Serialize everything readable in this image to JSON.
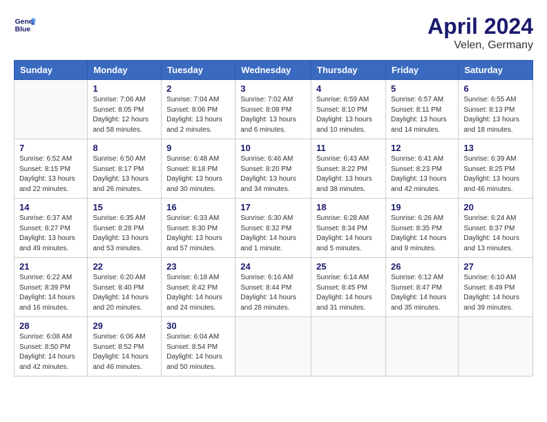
{
  "header": {
    "logo_line1": "General",
    "logo_line2": "Blue",
    "month": "April 2024",
    "location": "Velen, Germany"
  },
  "weekdays": [
    "Sunday",
    "Monday",
    "Tuesday",
    "Wednesday",
    "Thursday",
    "Friday",
    "Saturday"
  ],
  "weeks": [
    [
      {
        "day": "",
        "sunrise": "",
        "sunset": "",
        "daylight": ""
      },
      {
        "day": "1",
        "sunrise": "Sunrise: 7:06 AM",
        "sunset": "Sunset: 8:05 PM",
        "daylight": "Daylight: 12 hours and 58 minutes."
      },
      {
        "day": "2",
        "sunrise": "Sunrise: 7:04 AM",
        "sunset": "Sunset: 8:06 PM",
        "daylight": "Daylight: 13 hours and 2 minutes."
      },
      {
        "day": "3",
        "sunrise": "Sunrise: 7:02 AM",
        "sunset": "Sunset: 8:08 PM",
        "daylight": "Daylight: 13 hours and 6 minutes."
      },
      {
        "day": "4",
        "sunrise": "Sunrise: 6:59 AM",
        "sunset": "Sunset: 8:10 PM",
        "daylight": "Daylight: 13 hours and 10 minutes."
      },
      {
        "day": "5",
        "sunrise": "Sunrise: 6:57 AM",
        "sunset": "Sunset: 8:11 PM",
        "daylight": "Daylight: 13 hours and 14 minutes."
      },
      {
        "day": "6",
        "sunrise": "Sunrise: 6:55 AM",
        "sunset": "Sunset: 8:13 PM",
        "daylight": "Daylight: 13 hours and 18 minutes."
      }
    ],
    [
      {
        "day": "7",
        "sunrise": "Sunrise: 6:52 AM",
        "sunset": "Sunset: 8:15 PM",
        "daylight": "Daylight: 13 hours and 22 minutes."
      },
      {
        "day": "8",
        "sunrise": "Sunrise: 6:50 AM",
        "sunset": "Sunset: 8:17 PM",
        "daylight": "Daylight: 13 hours and 26 minutes."
      },
      {
        "day": "9",
        "sunrise": "Sunrise: 6:48 AM",
        "sunset": "Sunset: 8:18 PM",
        "daylight": "Daylight: 13 hours and 30 minutes."
      },
      {
        "day": "10",
        "sunrise": "Sunrise: 6:46 AM",
        "sunset": "Sunset: 8:20 PM",
        "daylight": "Daylight: 13 hours and 34 minutes."
      },
      {
        "day": "11",
        "sunrise": "Sunrise: 6:43 AM",
        "sunset": "Sunset: 8:22 PM",
        "daylight": "Daylight: 13 hours and 38 minutes."
      },
      {
        "day": "12",
        "sunrise": "Sunrise: 6:41 AM",
        "sunset": "Sunset: 8:23 PM",
        "daylight": "Daylight: 13 hours and 42 minutes."
      },
      {
        "day": "13",
        "sunrise": "Sunrise: 6:39 AM",
        "sunset": "Sunset: 8:25 PM",
        "daylight": "Daylight: 13 hours and 46 minutes."
      }
    ],
    [
      {
        "day": "14",
        "sunrise": "Sunrise: 6:37 AM",
        "sunset": "Sunset: 8:27 PM",
        "daylight": "Daylight: 13 hours and 49 minutes."
      },
      {
        "day": "15",
        "sunrise": "Sunrise: 6:35 AM",
        "sunset": "Sunset: 8:28 PM",
        "daylight": "Daylight: 13 hours and 53 minutes."
      },
      {
        "day": "16",
        "sunrise": "Sunrise: 6:33 AM",
        "sunset": "Sunset: 8:30 PM",
        "daylight": "Daylight: 13 hours and 57 minutes."
      },
      {
        "day": "17",
        "sunrise": "Sunrise: 6:30 AM",
        "sunset": "Sunset: 8:32 PM",
        "daylight": "Daylight: 14 hours and 1 minute."
      },
      {
        "day": "18",
        "sunrise": "Sunrise: 6:28 AM",
        "sunset": "Sunset: 8:34 PM",
        "daylight": "Daylight: 14 hours and 5 minutes."
      },
      {
        "day": "19",
        "sunrise": "Sunrise: 6:26 AM",
        "sunset": "Sunset: 8:35 PM",
        "daylight": "Daylight: 14 hours and 9 minutes."
      },
      {
        "day": "20",
        "sunrise": "Sunrise: 6:24 AM",
        "sunset": "Sunset: 8:37 PM",
        "daylight": "Daylight: 14 hours and 13 minutes."
      }
    ],
    [
      {
        "day": "21",
        "sunrise": "Sunrise: 6:22 AM",
        "sunset": "Sunset: 8:39 PM",
        "daylight": "Daylight: 14 hours and 16 minutes."
      },
      {
        "day": "22",
        "sunrise": "Sunrise: 6:20 AM",
        "sunset": "Sunset: 8:40 PM",
        "daylight": "Daylight: 14 hours and 20 minutes."
      },
      {
        "day": "23",
        "sunrise": "Sunrise: 6:18 AM",
        "sunset": "Sunset: 8:42 PM",
        "daylight": "Daylight: 14 hours and 24 minutes."
      },
      {
        "day": "24",
        "sunrise": "Sunrise: 6:16 AM",
        "sunset": "Sunset: 8:44 PM",
        "daylight": "Daylight: 14 hours and 28 minutes."
      },
      {
        "day": "25",
        "sunrise": "Sunrise: 6:14 AM",
        "sunset": "Sunset: 8:45 PM",
        "daylight": "Daylight: 14 hours and 31 minutes."
      },
      {
        "day": "26",
        "sunrise": "Sunrise: 6:12 AM",
        "sunset": "Sunset: 8:47 PM",
        "daylight": "Daylight: 14 hours and 35 minutes."
      },
      {
        "day": "27",
        "sunrise": "Sunrise: 6:10 AM",
        "sunset": "Sunset: 8:49 PM",
        "daylight": "Daylight: 14 hours and 39 minutes."
      }
    ],
    [
      {
        "day": "28",
        "sunrise": "Sunrise: 6:08 AM",
        "sunset": "Sunset: 8:50 PM",
        "daylight": "Daylight: 14 hours and 42 minutes."
      },
      {
        "day": "29",
        "sunrise": "Sunrise: 6:06 AM",
        "sunset": "Sunset: 8:52 PM",
        "daylight": "Daylight: 14 hours and 46 minutes."
      },
      {
        "day": "30",
        "sunrise": "Sunrise: 6:04 AM",
        "sunset": "Sunset: 8:54 PM",
        "daylight": "Daylight: 14 hours and 50 minutes."
      },
      {
        "day": "",
        "sunrise": "",
        "sunset": "",
        "daylight": ""
      },
      {
        "day": "",
        "sunrise": "",
        "sunset": "",
        "daylight": ""
      },
      {
        "day": "",
        "sunrise": "",
        "sunset": "",
        "daylight": ""
      },
      {
        "day": "",
        "sunrise": "",
        "sunset": "",
        "daylight": ""
      }
    ]
  ]
}
